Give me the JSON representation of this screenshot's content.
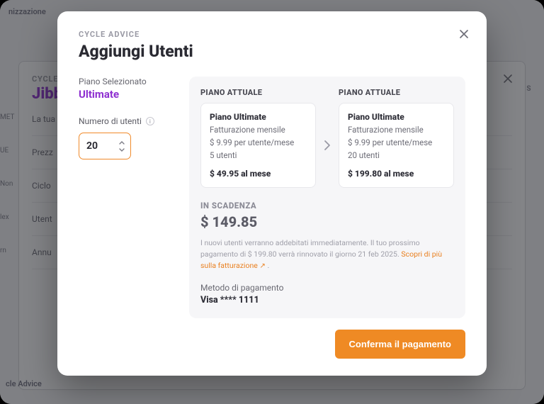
{
  "background": {
    "navTop": "nizzazione",
    "navBottom": "cle Advice",
    "badge": "IS",
    "sideLabels": [
      "MET",
      "UE",
      "Non",
      "lex",
      "rn"
    ],
    "card": {
      "eyebrow": "CYCLE",
      "title": "Jibb",
      "rows": [
        "La tua",
        "Prezz",
        "Ciclo",
        "Utent",
        "Annu"
      ]
    }
  },
  "modal": {
    "eyebrow": "CYCLE ADVICE",
    "title": "Aggiungi Utenti",
    "selectedPlanLabel": "Piano Selezionato",
    "selectedPlanName": "Ultimate",
    "usersLabel": "Numero di utenti",
    "usersValue": "20",
    "current": {
      "header": "PIANO ATTUALE",
      "title": "Piano Ultimate",
      "billing": "Fatturazione mensile",
      "price": "$ 9.99 per utente/mese",
      "users": "5 utenti",
      "total": "$ 49.95 al mese"
    },
    "next": {
      "header": "PIANO ATTUALE",
      "title": "Piano Ultimate",
      "billing": "Fatturazione mensile",
      "price": "$ 9.99 per utente/mese",
      "users": "20 utenti",
      "total": "$ 199.80 al mese"
    },
    "dueLabel": "IN SCADENZA",
    "dueAmount": "$ 149.85",
    "fine1": "I nuovi utenti verranno addebitati immediatamente. Il tuo prossimo pagamento di $ 199.80 verrà rinnovato il giorno 21 feb 2025. ",
    "fineLink": "Scopri di più sulla fatturazione",
    "pmLabel": "Metodo di pagamento",
    "pmValue": "Visa **** 1111",
    "cta": "Conferma il pagamento"
  }
}
